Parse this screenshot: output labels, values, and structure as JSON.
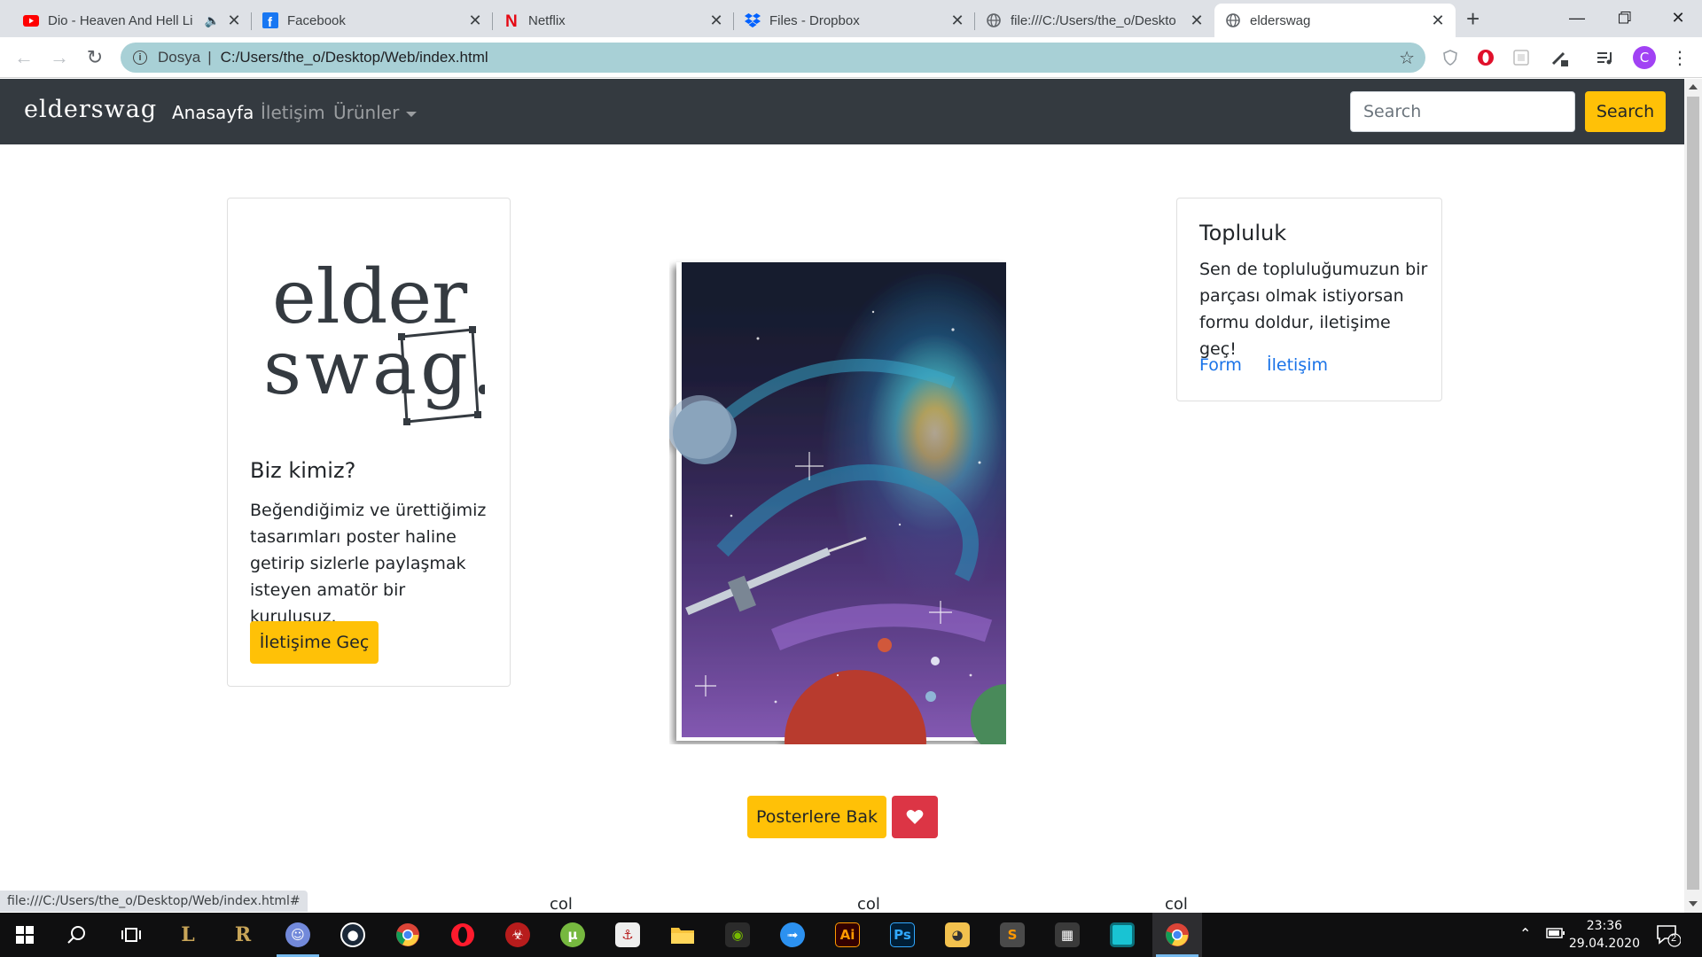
{
  "browser": {
    "tabs": [
      {
        "title": "Dio - Heaven And Hell Li",
        "favicon": "youtube-icon",
        "muted_audio": true
      },
      {
        "title": "Facebook",
        "favicon": "facebook-icon"
      },
      {
        "title": "Netflix",
        "favicon": "netflix-icon"
      },
      {
        "title": "Files - Dropbox",
        "favicon": "dropbox-icon"
      },
      {
        "title": "file:///C:/Users/the_o/Deskto",
        "favicon": "globe-icon"
      },
      {
        "title": "elderswag",
        "favicon": "globe-icon",
        "active": true
      }
    ],
    "new_tab": "+",
    "address": {
      "scheme_label": "Dosya",
      "url": "C:/Users/the_o/Desktop/Web/index.html"
    },
    "profile_initial": "C",
    "status_url": "file:///C:/Users/the_o/Desktop/Web/index.html#"
  },
  "site": {
    "brand": "elderswag",
    "nav": [
      {
        "label": "Anasayfa",
        "active": true
      },
      {
        "label": "İletişim"
      },
      {
        "label": "Ürünler",
        "dropdown": true
      }
    ],
    "search": {
      "placeholder": "Search",
      "button": "Search"
    },
    "about": {
      "logo_line1": "elder",
      "logo_line2": "swag.",
      "title": "Biz kimiz?",
      "text": "Beğendiğimiz ve ürettiğimiz tasarımları poster haline getirip sizlerle paylaşmak isteyen amatör bir kuruluşuz.",
      "button": "İletişime Geç"
    },
    "community": {
      "title": "Topluluk",
      "text": "Sen de topluluğumuzun bir parçası olmak istiyorsan formu doldur, iletişime geç!",
      "links": [
        "Form",
        "İletişim"
      ]
    },
    "posters_button": "Posterlere Bak",
    "like_icon": "heart-icon",
    "cols": [
      "col",
      "col",
      "col"
    ]
  },
  "taskbar": {
    "time": "23:36",
    "date": "29.04.2020",
    "notifications": "2",
    "apps": [
      "windows-start-icon",
      "search-icon",
      "task-view-icon",
      "league-of-legends-icon",
      "riot-icon",
      "discord-icon",
      "steam-icon",
      "chrome-icon",
      "opera-icon",
      "game-icon",
      "utorrent-icon",
      "app-icon",
      "file-explorer-icon",
      "nvidia-icon",
      "messenger-icon",
      "illustrator-icon",
      "photoshop-icon",
      "app2-icon",
      "sublime-icon",
      "app3-icon",
      "app4-icon",
      "chrome-active-icon"
    ],
    "illustrator_label": "Ai",
    "photoshop_label": "Ps"
  },
  "colors": {
    "navbar": "#343a40",
    "warning": "#ffc107",
    "danger": "#dc3545",
    "omnibox": "#a8d0d6"
  }
}
